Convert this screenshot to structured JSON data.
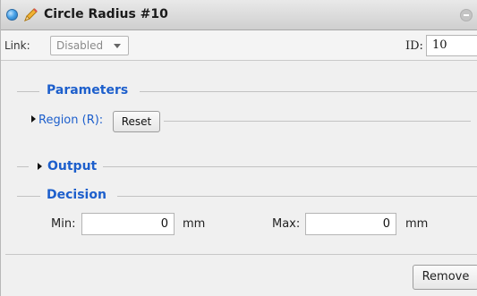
{
  "window": {
    "title": "Circle Radius #10",
    "status_icon": "blue-status-dot",
    "edit_icon": "pencil-icon",
    "collapse_icon": "minus-circle-icon"
  },
  "link_row": {
    "link_label": "Link:",
    "link_value": "Disabled",
    "id_label": "ID:",
    "id_value": "10"
  },
  "parameters": {
    "title": "Parameters",
    "region_label": "Region (R):",
    "reset_label": "Reset"
  },
  "output": {
    "title": "Output"
  },
  "decision": {
    "title": "Decision",
    "min_label": "Min:",
    "min_value": "0",
    "min_unit": "mm",
    "max_label": "Max:",
    "max_value": "0",
    "max_unit": "mm"
  },
  "footer": {
    "remove_label": "Remove"
  },
  "colors": {
    "section_title": "#1d5fcc",
    "panel_bg": "#f0f0f0"
  }
}
